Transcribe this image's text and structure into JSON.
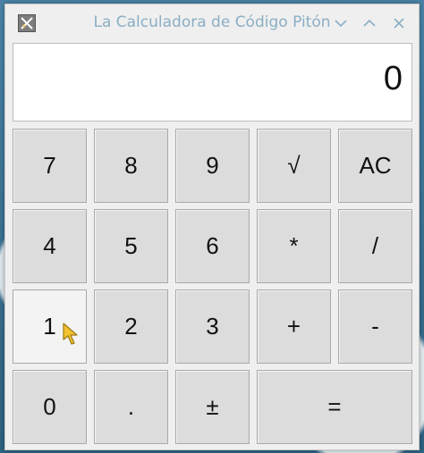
{
  "window": {
    "title": "La Calculadora de Código Pitón"
  },
  "display": {
    "value": "0"
  },
  "keys": {
    "row1": [
      "7",
      "8",
      "9",
      "√",
      "AC"
    ],
    "row2": [
      "4",
      "5",
      "6",
      "*",
      "/"
    ],
    "row3": [
      "1",
      "2",
      "3",
      "+",
      "-"
    ],
    "row4": [
      "0",
      ".",
      "±",
      "="
    ]
  },
  "icons": {
    "app": "calculator-app-icon",
    "minimize": "chevron-down-icon",
    "maximize": "chevron-up-icon",
    "close": "close-icon",
    "cursor": "pointer-cursor-icon"
  },
  "colors": {
    "key_background": "#dcdcdc",
    "key_hover": "#f3f3f3",
    "window_background": "#efefef",
    "title_text": "#8aaec4"
  }
}
